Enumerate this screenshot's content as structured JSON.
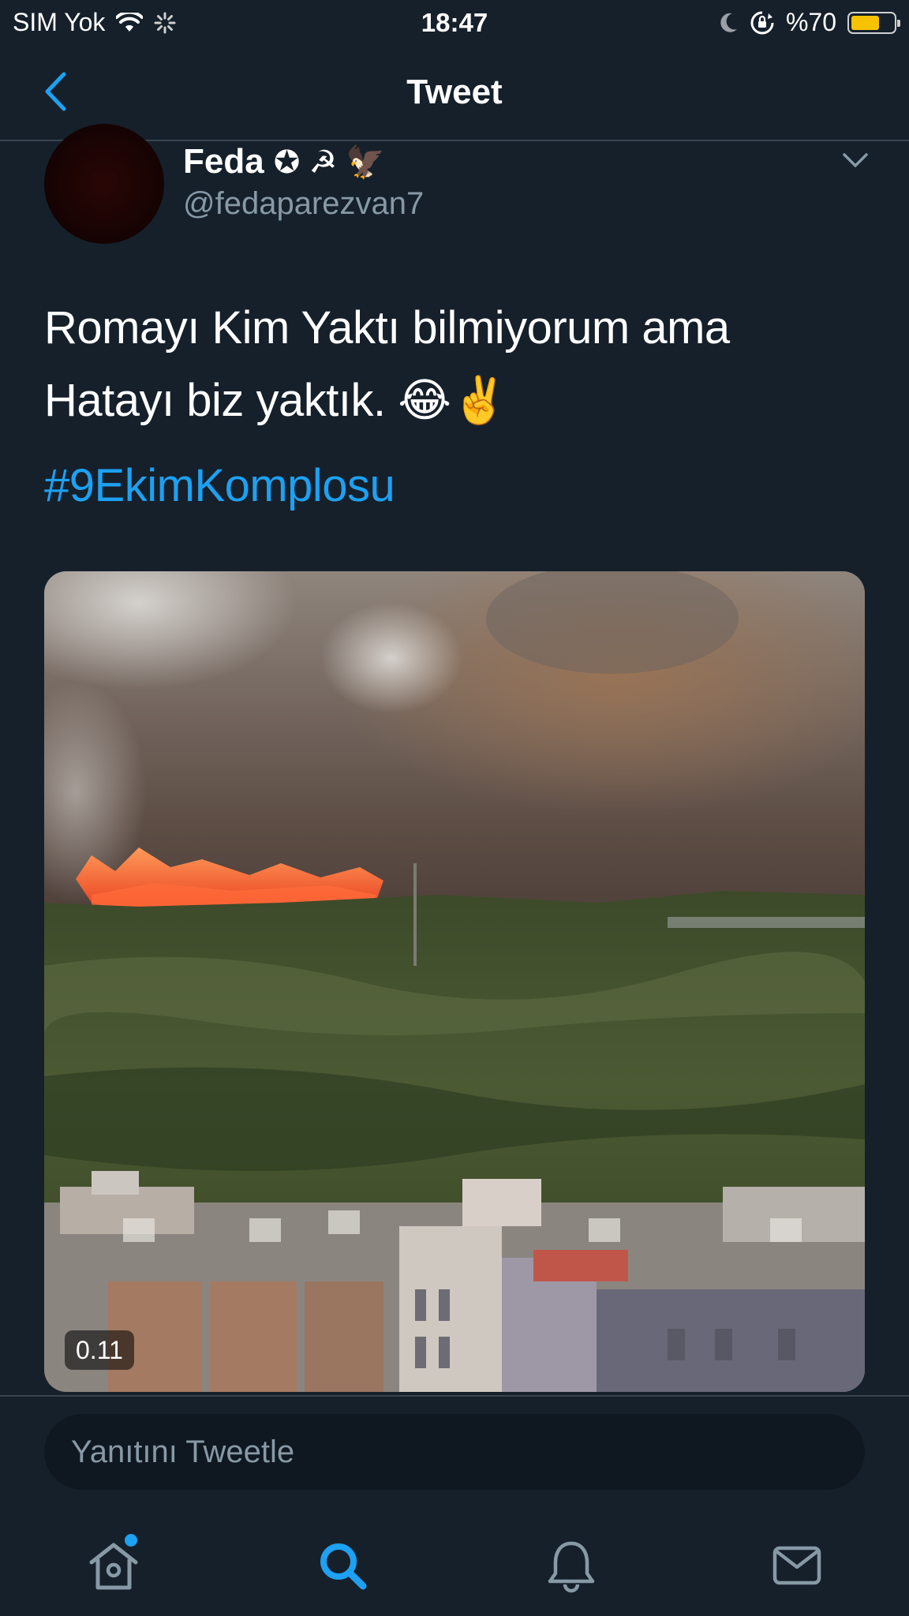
{
  "status_bar": {
    "carrier": "SIM Yok",
    "time": "18:47",
    "battery_percent": "%70",
    "battery_level": 0.7
  },
  "header": {
    "title": "Tweet"
  },
  "tweet": {
    "display_name": "Feda",
    "name_symbols": "✪ ☭ 🦅",
    "handle": "@fedaparezvan7",
    "text_lines": [
      "Romayı Kim Yaktı bilmiyorum ama",
      "Hatayı biz yaktık. 😂✌️"
    ],
    "hashtag": "#9EkimKomplosu",
    "video_time": "0.11"
  },
  "reply": {
    "placeholder": "Yanıtını Tweetle"
  },
  "tab_bar": {
    "items": [
      "home-icon",
      "search-icon",
      "bell-icon",
      "mail-icon"
    ],
    "active": "search-icon",
    "active_color": "#1da1f2",
    "inactive_color": "#8899a6"
  },
  "colors": {
    "background": "#15202b",
    "accent": "#1da1f2",
    "secondary_text": "#8899a6",
    "battery": "#f7c300"
  }
}
